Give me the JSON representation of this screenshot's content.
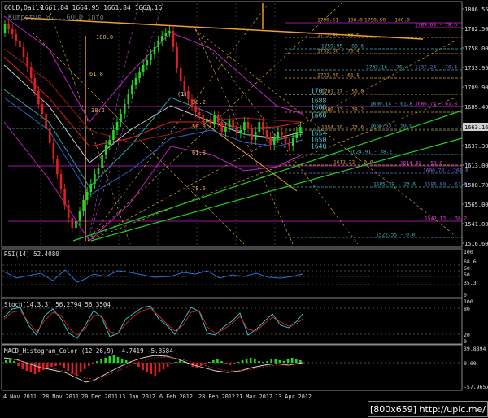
{
  "colors": {
    "bg": "#000000",
    "grid": "#5a5a5a",
    "up": "#22d822",
    "down": "#e02020",
    "upper": "#c020c0",
    "fibo": "#c8a040",
    "trend": "#20d020",
    "price_tag": "#d0d0d0"
  },
  "main": {
    "header": {
      "symbol": "GOLD,Daily",
      "ohlc": "1661.84 1664.95 1661.84 1663.16"
    },
    "watermark": "Kumpotus @ ...GOLD info",
    "price_scale": [
      "1806.55",
      "1782.50",
      "1758.00",
      "1733.95",
      "1709.90",
      "1685.40",
      "1661.35",
      "1637.30",
      "1613.00",
      "1588.70",
      "1565.00",
      "1541.00",
      "1516.60"
    ],
    "current_price": "1663.16",
    "levels": [
      {
        "label": "1790.51 - 100.0",
        "color": "#d8a040"
      },
      {
        "label": "1790.50 - 100.0",
        "color": "#d8a040"
      },
      {
        "label": "1789.68 - 78.6",
        "color": "#e040e0"
      },
      {
        "label": "1775.46 - 88.6",
        "color": "#d8a040"
      },
      {
        "label": "1759.95 - 88.6",
        "color": "#40b0c0"
      },
      {
        "label": "1752.36 - 76.4",
        "color": "#d8a040"
      },
      {
        "label": "1733.16 - 76.4",
        "color": "#40b0c0"
      },
      {
        "label": "1732.24 - 76.4",
        "color": "#7070d0"
      },
      {
        "label": "1722.40 - 61.8",
        "color": "#d8a040"
      },
      {
        "label": "1701",
        "color": "#40d0e0"
      },
      {
        "label": "1701.37 - 50.0",
        "color": "#d8a040"
      },
      {
        "label": "1688",
        "color": "#40d0e0"
      },
      {
        "label": "1680.14 - 61.8",
        "color": "#40b0c0"
      },
      {
        "label": "1686.74 - 61.8",
        "color": "#e040e0"
      },
      {
        "label": "1680",
        "color": "#40d0e0"
      },
      {
        "label": "1680.33 - 38.2",
        "color": "#d8a040"
      },
      {
        "label": "1668",
        "color": "#40d0e0"
      },
      {
        "label": "1654.30 - 23.6",
        "color": "#d8a040"
      },
      {
        "label": "1656.53 - 50.0",
        "color": "#40b0c0"
      },
      {
        "label": "1654",
        "color": "#40d0e0"
      },
      {
        "label": "1650",
        "color": "#40d0e0"
      },
      {
        "label": "1640",
        "color": "#40d0e0"
      },
      {
        "label": "1624.91 - 38.2",
        "color": "#40b0c0"
      },
      {
        "label": "1612.22 - 0.0",
        "color": "#d8a040"
      },
      {
        "label": "1614.43 - 50.0",
        "color": "#e040e0"
      },
      {
        "label": "1600.79 - 261.8",
        "color": "#7070d0"
      },
      {
        "label": "1585.79 - 23.6",
        "color": "#40b0c0"
      },
      {
        "label": "1586.00 - 61.8",
        "color": "#7070d0"
      },
      {
        "label": "1542.13 - 38.2",
        "color": "#e040e0"
      },
      {
        "label": "1522.55 - 0.0",
        "color": "#40b0c0"
      }
    ],
    "chart_labels": [
      "100.0",
      "61.8",
      "50.0",
      "38.2",
      "50.0",
      "61.8",
      "78.6",
      "38.2",
      "(2)",
      "(1)"
    ]
  },
  "rsi": {
    "title": "RSI(14) 52.4080",
    "scale": [
      "100",
      "68.6",
      "60",
      "50",
      "35.3",
      "0"
    ]
  },
  "stoch": {
    "title": "Stoch(14,3,3) 56.2794 56.3504",
    "scale": [
      "100",
      "80",
      "20",
      "0"
    ]
  },
  "macd": {
    "title": "MACD_Histogram_Color (12,26,9) -4.7419 -5.8584",
    "scale": [
      "39.8894",
      "0.00",
      "-57.9657"
    ]
  },
  "x_axis": [
    "4 Nov 2011",
    "28 Nov 2011",
    "20 Dec 2011",
    "13 Jan 2012",
    "6 Feb 2012",
    "28 Feb 2012",
    "21 Mar 2012",
    "13 Apr 2012"
  ],
  "watermark_tag": "[800x659] http://upic.me/"
}
